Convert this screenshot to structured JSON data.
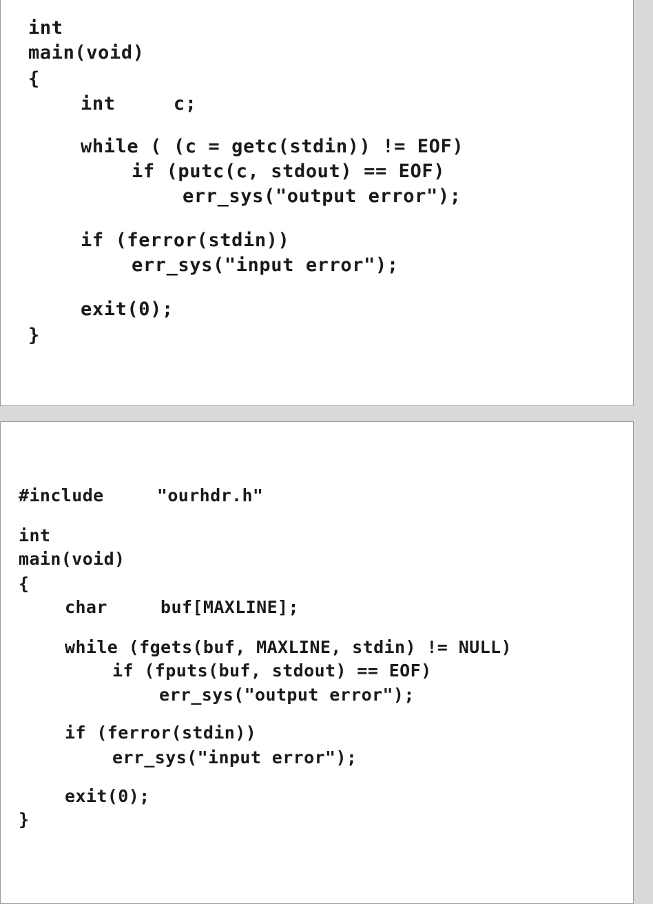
{
  "snippet_1": {
    "lines": [
      "int",
      "main(void)",
      "{",
      "int     c;",
      "while ( (c = getc(stdin)) != EOF)",
      "if (putc(c, stdout) == EOF)",
      "err_sys(\"output error\");",
      "if (ferror(stdin))",
      "err_sys(\"input error\");",
      "exit(0);",
      "}"
    ]
  },
  "snippet_2": {
    "lines": [
      "#include     \"ourhdr.h\"",
      "int",
      "main(void)",
      "{",
      "char     buf[MAXLINE];",
      "while (fgets(buf, MAXLINE, stdin) != NULL)",
      "if (fputs(buf, stdout) == EOF)",
      "err_sys(\"output error\");",
      "if (ferror(stdin))",
      "err_sys(\"input error\");",
      "exit(0);",
      "}"
    ]
  }
}
